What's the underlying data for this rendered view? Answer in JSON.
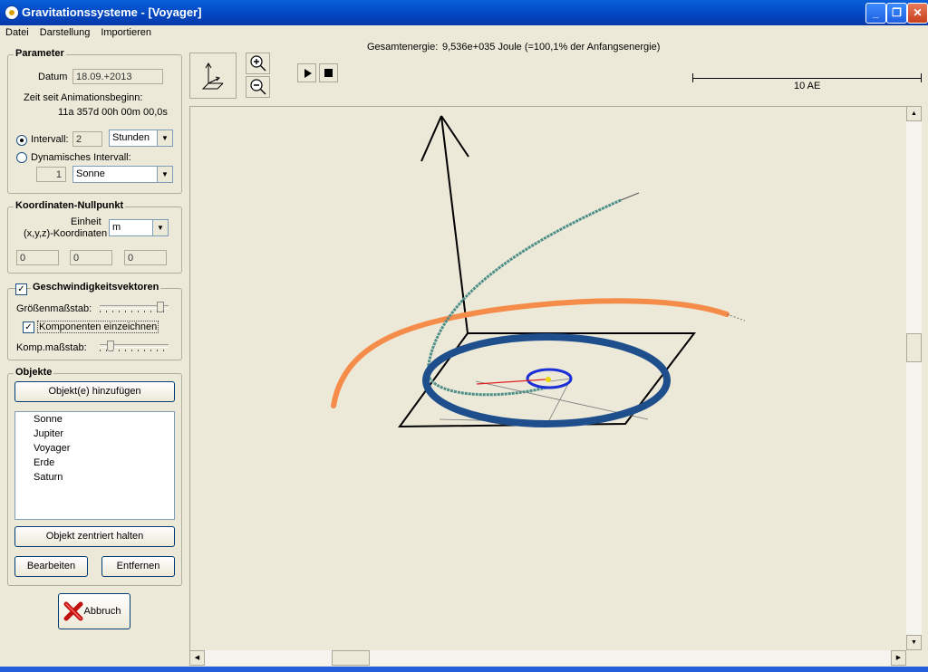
{
  "window": {
    "title": "Gravitationssysteme - [Voyager]"
  },
  "titlebar_buttons": {
    "minimize": "_",
    "restore": "❐",
    "close": "✕"
  },
  "menu": [
    "Datei",
    "Darstellung",
    "Importieren"
  ],
  "parameter": {
    "title": "Parameter",
    "date_label": "Datum",
    "date_value": "18.09.+2013",
    "elapsed_label": "Zeit seit Animationsbeginn:",
    "elapsed_value": "11a 357d 00h 00m 00,0s",
    "interval_label": "Intervall:",
    "interval_value": "2",
    "interval_unit": "Stunden",
    "dynamic_label": "Dynamisches Intervall:",
    "dynamic_value": "1",
    "dynamic_body": "Sonne"
  },
  "coords": {
    "title": "Koordinaten-Nullpunkt",
    "unit_label_1": "Einheit",
    "unit_label_2": "(x,y,z)-Koordinaten",
    "unit_value": "m",
    "x": "0",
    "y": "0",
    "z": "0"
  },
  "velocity": {
    "title": "Geschwindigkeitsvektoren",
    "checked_mark": "✓",
    "scale_label": "Größenmaßstab:",
    "scale_level": 0.92,
    "components_label": "Komponenten einzeichnen",
    "components_mark": "✓",
    "comp_scale_label": "Komp.maßstab:",
    "comp_scale_level": 0.12
  },
  "objects": {
    "title": "Objekte",
    "add_button": "Objekt(e) hinzufügen",
    "items": [
      "Sonne",
      "Jupiter",
      "Voyager",
      "Erde",
      "Saturn"
    ],
    "center_button": "Objekt zentriert halten",
    "edit_button": "Bearbeiten",
    "remove_button": "Entfernen"
  },
  "abort_button": "Abbruch",
  "energy": {
    "label": "Gesamtenergie:",
    "value": "9,536e+035 Joule (=100,1% der Anfangsenergie)"
  },
  "scale_bar": {
    "label": "10 AE"
  },
  "colors": {
    "jupiter_orbit": "#1e4f8c",
    "earth_orbit": "#1a2fd6",
    "voyager_path": "#4f8f8a",
    "saturn_path": "#f58c4a",
    "sun": "#e8d800",
    "velocity_vector": "#e02020"
  },
  "icons": [
    "app-icon",
    "axes-view-icon",
    "zoom-in-icon",
    "zoom-out-icon",
    "play-icon",
    "stop-icon",
    "abort-x-icon"
  ]
}
